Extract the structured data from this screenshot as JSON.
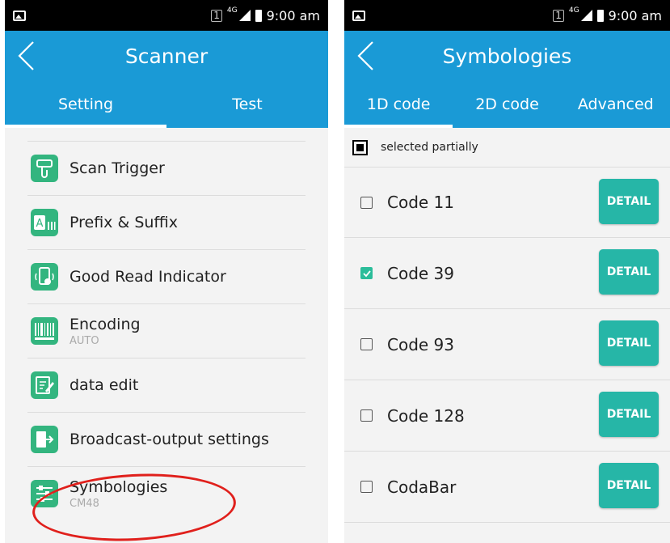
{
  "colors": {
    "accent": "#1a9ad6",
    "icon_green": "#33b57f",
    "detail_button": "#26b6a7",
    "highlight": "#e0201c"
  },
  "left": {
    "status": {
      "sim": "1",
      "network": "4G",
      "time": "9:00 am"
    },
    "title": "Scanner",
    "tabs": [
      {
        "label": "Setting",
        "active": true
      },
      {
        "label": "Test",
        "active": false
      }
    ],
    "items": [
      {
        "label": "Scan Trigger",
        "sub": "",
        "icon": "scan-trigger-icon"
      },
      {
        "label": "Prefix & Suffix",
        "sub": "",
        "icon": "prefix-suffix-icon"
      },
      {
        "label": "Good Read Indicator",
        "sub": "",
        "icon": "good-read-indicator-icon"
      },
      {
        "label": "Encoding",
        "sub": "AUTO",
        "icon": "barcode-icon"
      },
      {
        "label": "data edit",
        "sub": "",
        "icon": "edit-icon"
      },
      {
        "label": "Broadcast-output settings",
        "sub": "",
        "icon": "broadcast-output-icon"
      },
      {
        "label": "Symbologies",
        "sub": "CM48",
        "icon": "symbologies-icon"
      }
    ]
  },
  "right": {
    "status": {
      "sim": "1",
      "network": "4G",
      "time": "9:00 am"
    },
    "title": "Symbologies",
    "tabs": [
      {
        "label": "1D code",
        "active": true
      },
      {
        "label": "2D code",
        "active": false
      },
      {
        "label": "Advanced",
        "active": false
      }
    ],
    "legend": "selected partially",
    "codes": [
      {
        "label": "Code 11",
        "checked": false,
        "button": "DETAIL"
      },
      {
        "label": "Code 39",
        "checked": true,
        "button": "DETAIL"
      },
      {
        "label": "Code 93",
        "checked": false,
        "button": "DETAIL"
      },
      {
        "label": "Code 128",
        "checked": false,
        "button": "DETAIL"
      },
      {
        "label": "CodaBar",
        "checked": false,
        "button": "DETAIL"
      }
    ]
  }
}
